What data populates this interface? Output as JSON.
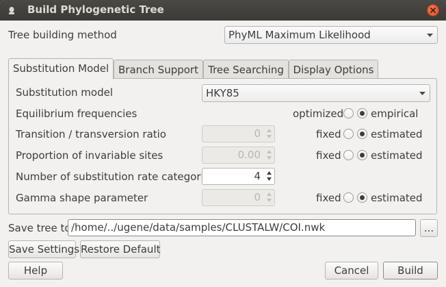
{
  "window": {
    "title": "Build Phylogenetic Tree"
  },
  "method": {
    "label": "Tree building method",
    "value": "PhyML Maximum Likelihood"
  },
  "tabs": [
    {
      "label": "Substitution Model",
      "active": true
    },
    {
      "label": "Branch Support",
      "active": false
    },
    {
      "label": "Tree Searching",
      "active": false
    },
    {
      "label": "Display Options",
      "active": false
    }
  ],
  "model": {
    "substitution_model": {
      "label": "Substitution model",
      "value": "HKY85"
    },
    "equilibrium": {
      "label": "Equilibrium frequencies",
      "opt1": "optimized",
      "opt2": "empirical",
      "selected": "empirical"
    },
    "ts_tv": {
      "label": "Transition / transversion ratio",
      "value": "0",
      "opt1": "fixed",
      "opt2": "estimated",
      "selected": "estimated"
    },
    "invariable": {
      "label": "Proportion of invariable sites",
      "value": "0.00",
      "opt1": "fixed",
      "opt2": "estimated",
      "selected": "estimated"
    },
    "rate_categories": {
      "label": "Number of substitution rate categories",
      "value": "4"
    },
    "gamma": {
      "label": "Gamma shape parameter",
      "value": "0",
      "opt1": "fixed",
      "opt2": "estimated",
      "selected": "estimated"
    }
  },
  "save": {
    "label": "Save tree to",
    "path": "/home/../ugene/data/samples/CLUSTALW/COI.nwk",
    "browse": "..."
  },
  "buttons": {
    "save_settings": "Save Settings",
    "restore_default": "Restore Default",
    "help": "Help",
    "cancel": "Cancel",
    "build": "Build"
  }
}
